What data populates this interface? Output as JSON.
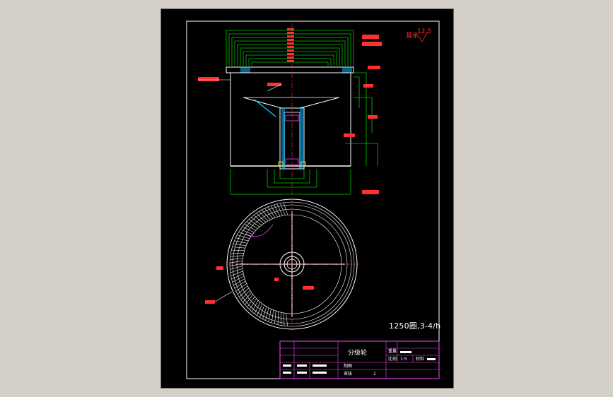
{
  "drawing": {
    "title": "分级轮",
    "surface_finish": "12.5",
    "finish_note": "其余",
    "spec_note": "1250圈,3-4/h",
    "title_block": {
      "label_weight": "重量",
      "label_scale": "比例",
      "label_material": "材料",
      "scale_value": "1:5",
      "label_drawn": "制图",
      "label_checked": "审核",
      "sheet_count": "1"
    }
  }
}
